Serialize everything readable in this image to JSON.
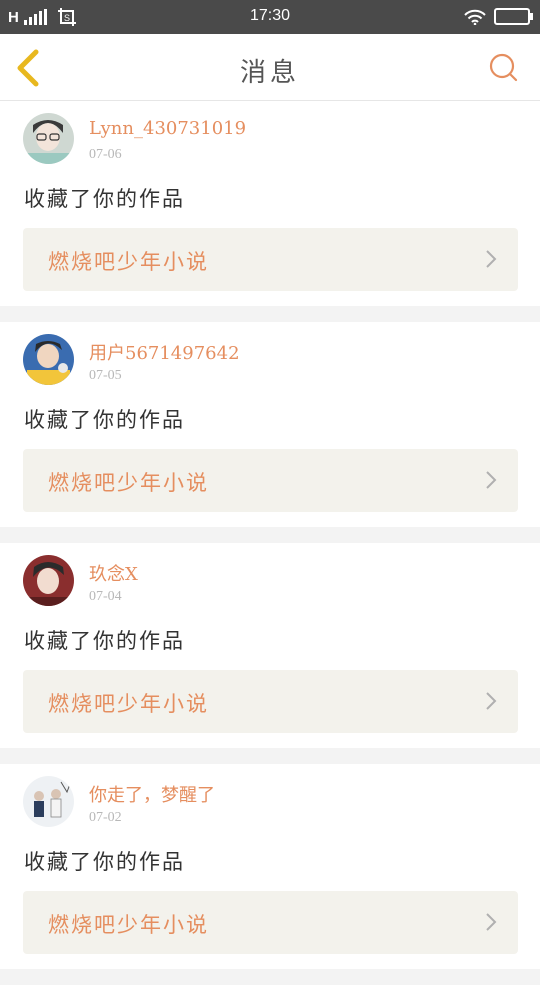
{
  "status_bar": {
    "carrier": "H",
    "time": "17:30"
  },
  "header": {
    "title": "消息"
  },
  "feed": [
    {
      "username": "Lynn_430731019",
      "date": "07-06",
      "action": "收藏了你的作品",
      "work_title": "燃烧吧少年小说"
    },
    {
      "username": "用户5671497642",
      "date": "07-05",
      "action": "收藏了你的作品",
      "work_title": "燃烧吧少年小说"
    },
    {
      "username": "玖念X",
      "date": "07-04",
      "action": "收藏了你的作品",
      "work_title": "燃烧吧少年小说"
    },
    {
      "username": "你走了，梦醒了",
      "date": "07-02",
      "action": "收藏了你的作品",
      "work_title": "燃烧吧少年小说"
    }
  ],
  "colors": {
    "accent": "#e58e5f",
    "back_arrow": "#e8b81f",
    "status_bar": "#4a4a4a",
    "card_tile": "#f3f2ec"
  }
}
